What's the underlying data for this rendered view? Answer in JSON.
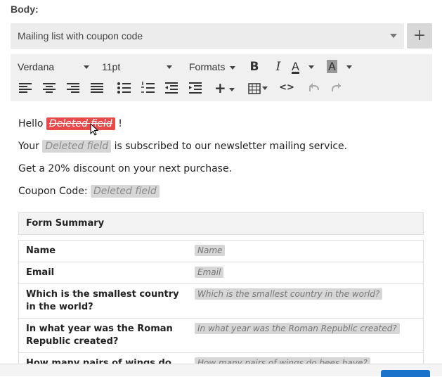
{
  "body_label": "Body:",
  "template_select": {
    "value": "Mailing list with coupon code"
  },
  "add_button": "+",
  "toolbar": {
    "font_family": "Verdana",
    "font_size": "11pt",
    "formats": "Formats",
    "bold": "B",
    "italic": "I",
    "text_color": "A",
    "bg_color": "A"
  },
  "editor": {
    "line1": {
      "prefix": "Hello",
      "field": "Deleted field",
      "suffix": "!"
    },
    "line2": {
      "prefix": "Your",
      "field": "Deleted field",
      "suffix": "is subscribed to our newsletter mailing service."
    },
    "line3": "Get a 20% discount on your next purchase.",
    "line4": {
      "prefix": "Coupon Code:",
      "field": "Deleted field"
    },
    "summary": {
      "title": "Form Summary",
      "rows": [
        {
          "q": "Name",
          "a": "Name"
        },
        {
          "q": "Email",
          "a": "Email"
        },
        {
          "q": "Which is the smallest country in the world?",
          "a": "Which is the smallest country in the world?"
        },
        {
          "q": "In what year was the Roman Republic created?",
          "a": "In what year was the Roman Republic created?"
        },
        {
          "q": "How many pairs of wings do",
          "a": "How many pairs of wings do bees have?"
        }
      ]
    }
  }
}
